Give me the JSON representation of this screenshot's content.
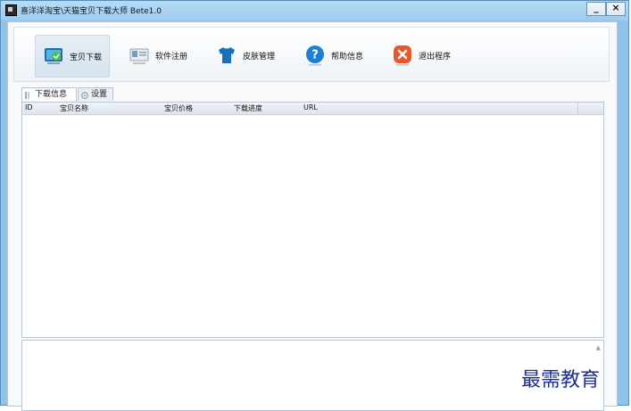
{
  "window": {
    "title": "喜洋洋淘宝\\天猫宝贝下载大师 Bete1.0",
    "minimize_label": "_",
    "close_label": "×"
  },
  "toolbar": {
    "items": [
      {
        "label": "宝贝下载",
        "icon": "download-icon",
        "active": true
      },
      {
        "label": "软件注册",
        "icon": "registration-card-icon",
        "active": false
      },
      {
        "label": "皮肤管理",
        "icon": "tshirt-icon",
        "active": false
      },
      {
        "label": "帮助信息",
        "icon": "help-icon",
        "active": false
      },
      {
        "label": "退出程序",
        "icon": "exit-icon",
        "active": false
      }
    ]
  },
  "tabs": [
    {
      "label": "下载信息",
      "icon": "list-icon",
      "active": true
    },
    {
      "label": "设置",
      "icon": "settings-icon",
      "active": false
    }
  ],
  "list": {
    "columns": [
      "ID",
      "宝贝名称",
      "宝贝价格",
      "下载进度",
      "URL"
    ],
    "rows": []
  },
  "watermark": {
    "text": "最需教育"
  },
  "colors": {
    "title_bar": "#9dcbee",
    "frame": "#8fc4e8",
    "help_icon": "#1f7fd0",
    "exit_icon": "#e8572a",
    "shirt_icon": "#1b6fb4"
  }
}
